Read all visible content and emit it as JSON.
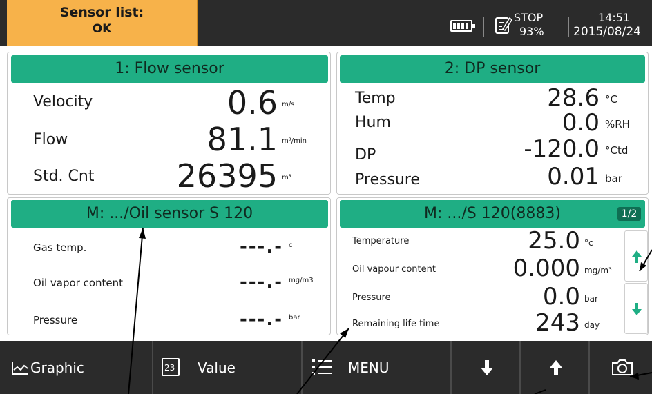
{
  "status_bar": {
    "sensor_list_title": "Sensor list:",
    "sensor_list_status": "OK",
    "battery_icon": "battery-icon",
    "record_icon": "record-icon",
    "record_state": "STOP",
    "record_percent": "93%",
    "time": "14:51",
    "date": "2015/08/24"
  },
  "panels": {
    "flow": {
      "title": "1: Flow sensor",
      "rows": [
        {
          "label": "Velocity",
          "value": "0.6",
          "unit": "m/s"
        },
        {
          "label": "Flow",
          "value": "81.1",
          "unit": "m³/min"
        },
        {
          "label": "Std. Cnt",
          "value": "26395",
          "unit": "m³"
        }
      ]
    },
    "dp": {
      "title": "2: DP sensor",
      "rows": [
        {
          "label": "Temp",
          "value": "28.6",
          "unit": "°C"
        },
        {
          "label": "Hum",
          "value": "0.0",
          "unit": "%RH"
        },
        {
          "label": "DP",
          "value": "-120.0",
          "unit": "°Ctd"
        },
        {
          "label": "Pressure",
          "value": "0.01",
          "unit": "bar"
        }
      ]
    },
    "oil": {
      "title": "M: .../Oil sensor S 120",
      "rows": [
        {
          "label": "Gas temp.",
          "value": "---.-",
          "unit": "c"
        },
        {
          "label": "Oil vapor content",
          "value": "---.-",
          "unit": "mg/m3"
        },
        {
          "label": "Pressure",
          "value": "---.-",
          "unit": "bar"
        }
      ]
    },
    "s120": {
      "title": "M: .../S 120(8883)",
      "page": "1/2",
      "rows": [
        {
          "label": "Temperature",
          "value": "25.0",
          "unit": "°c"
        },
        {
          "label": "Oil vapour content",
          "value": "0.000",
          "unit": "mg/m³"
        },
        {
          "label": "Pressure",
          "value": "0.0",
          "unit": "bar"
        },
        {
          "label": "Remaining life time",
          "value": "243",
          "unit": "day"
        }
      ]
    }
  },
  "bottom_bar": {
    "graphic_label": "Graphic",
    "value_icon_text": "23",
    "value_label": "Value",
    "menu_label": "MENU"
  },
  "colors": {
    "header_green": "#1fae84",
    "status_orange": "#f7b24a",
    "bar_dark": "#2b2b2b"
  }
}
